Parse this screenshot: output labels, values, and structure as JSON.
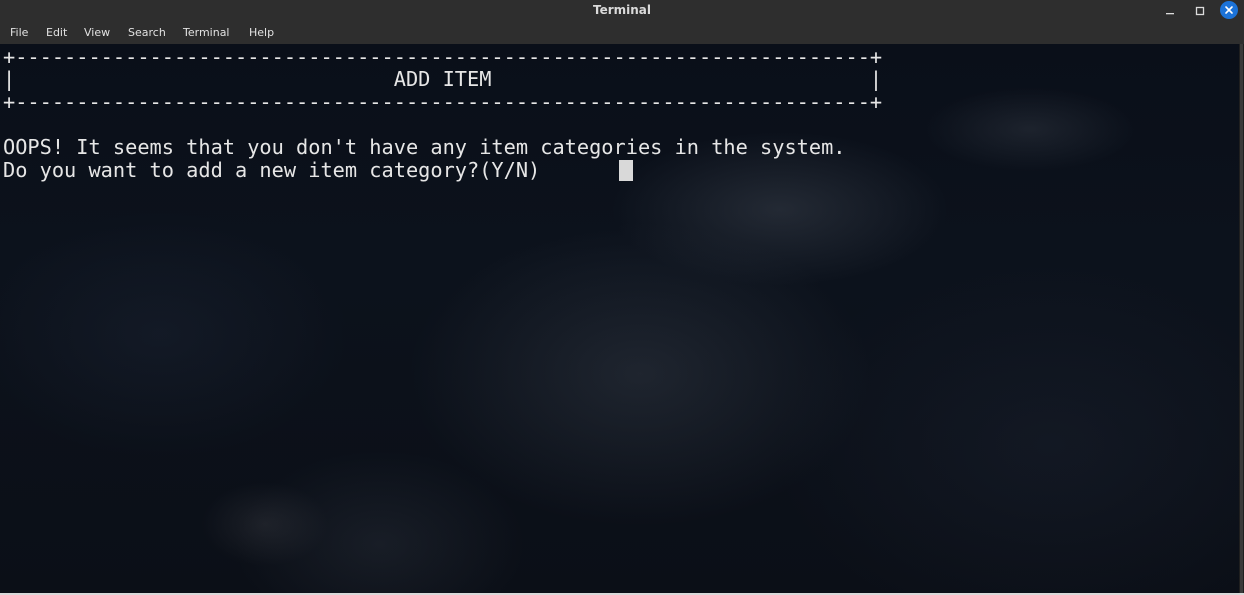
{
  "window": {
    "title": "Terminal",
    "controls": {
      "minimize_icon": "minimize-icon",
      "maximize_icon": "maximize-icon",
      "close_icon": "close-icon",
      "close_color": "#1c73d8"
    }
  },
  "menubar": {
    "items": [
      {
        "label": "File"
      },
      {
        "label": "Edit"
      },
      {
        "label": "View"
      },
      {
        "label": "Search"
      },
      {
        "label": "Terminal"
      },
      {
        "label": "Help"
      }
    ]
  },
  "terminal": {
    "lines": [
      "+----------------------------------------------------------------------+",
      "|                               ADD ITEM                               |",
      "+----------------------------------------------------------------------+",
      "",
      "OOPS! It seems that you don't have any item categories in the system.",
      "Do you want to add a new item category?(Y/N) "
    ],
    "text_color": "#e6e6e6",
    "background": "dark cloudy night sky"
  }
}
